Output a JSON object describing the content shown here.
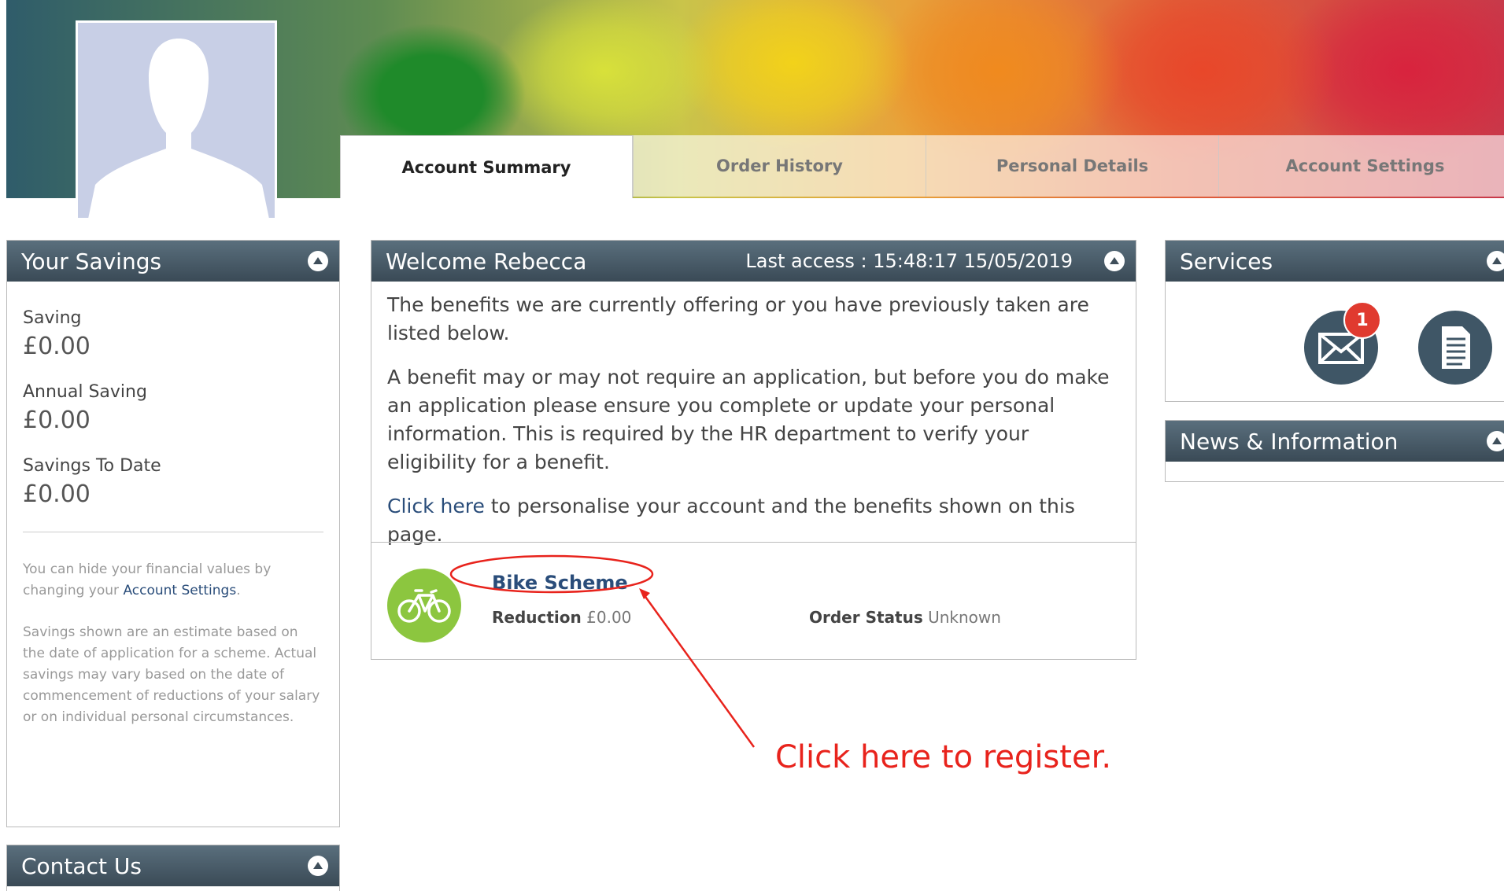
{
  "tabs": [
    {
      "label": "Account Summary",
      "active": true
    },
    {
      "label": "Order History",
      "active": false
    },
    {
      "label": "Personal Details",
      "active": false
    },
    {
      "label": "Account Settings",
      "active": false
    }
  ],
  "savings": {
    "title": "Your Savings",
    "saving_label": "Saving",
    "saving_value": "£0.00",
    "annual_label": "Annual Saving",
    "annual_value": "£0.00",
    "todate_label": "Savings To Date",
    "todate_value": "£0.00",
    "hide_note_prefix": "You can hide your financial values by changing your ",
    "hide_note_link": "Account Settings",
    "hide_note_suffix": ".",
    "estimate_note": "Savings shown are an estimate based on the date of application for a scheme. Actual savings may vary based on the date of commencement of reductions of your salary or on individual personal circumstances."
  },
  "contact": {
    "title": "Contact Us"
  },
  "welcome": {
    "title": "Welcome Rebecca",
    "last_access": "Last access : 15:48:17 15/05/2019",
    "para1": "The benefits we are currently offering or you have previously taken are listed below.",
    "para2": "A benefit may or may not require an application, but before you do make an application please ensure you complete or update your personal information. This is required by the HR department to verify your eligibility for a benefit.",
    "click_link": "Click here",
    "click_rest": " to personalise your account and the benefits shown on this page."
  },
  "benefit": {
    "name": "Bike Scheme",
    "reduction_label": "Reduction",
    "reduction_value": "£0.00",
    "status_label": "Order Status",
    "status_value": "Unknown",
    "icon": "bicycle-icon",
    "icon_color": "#8cc63f"
  },
  "services": {
    "title": "Services",
    "mail_badge": "1",
    "badge_color": "#e03a2f"
  },
  "news": {
    "title": "News & Information"
  },
  "annotation": {
    "text": "Click here to register.",
    "color": "#e8231c"
  }
}
